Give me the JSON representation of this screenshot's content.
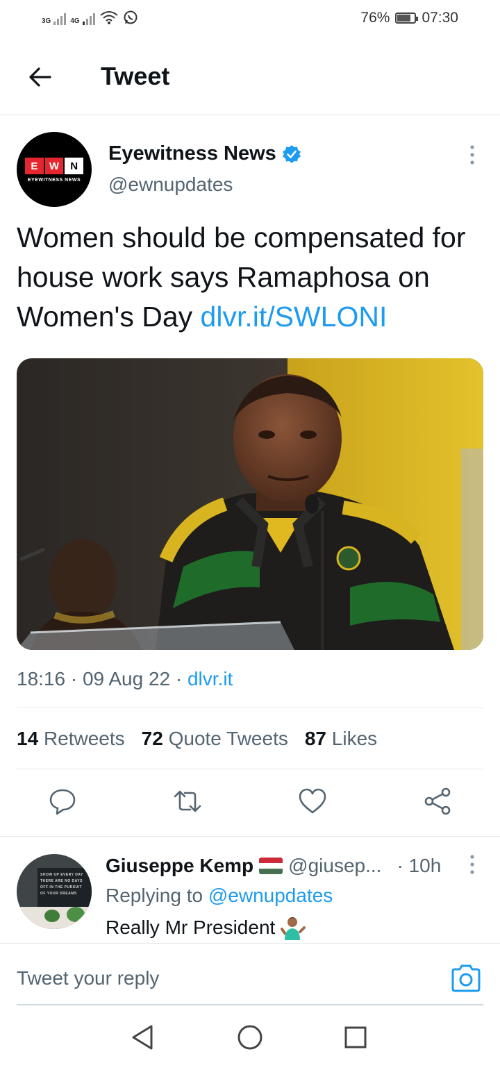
{
  "status_bar": {
    "network1": "3G",
    "network2": "4G",
    "battery": "76%",
    "battery_level": 0.76,
    "time": "07:30"
  },
  "header": {
    "title": "Tweet",
    "back_icon": "arrow-left-icon"
  },
  "tweet": {
    "author_name": "Eyewitness News",
    "author_handle": "@ewnupdates",
    "avatar_logo_letters": [
      "E",
      "W",
      "N"
    ],
    "avatar_logo_sub": "EYEWITNESS NEWS",
    "verified": true,
    "text": "Women should be compensated for house work says Ramaphosa on Women's Day ",
    "link_text": "dlvr.it/SWLONI",
    "time": "18:16",
    "date": "09 Aug 22",
    "source": "dlvr.it",
    "stats": {
      "retweets_count": "14",
      "retweets_label": "Retweets",
      "quotes_count": "72",
      "quotes_label": "Quote Tweets",
      "likes_count": "87",
      "likes_label": "Likes"
    },
    "actions": [
      "reply-icon",
      "retweet-icon",
      "like-icon",
      "share-icon"
    ]
  },
  "reply": {
    "name": "Giuseppe Kemp",
    "handle": "@giusep...",
    "time": "· 10h",
    "replying_prefix": "Replying to ",
    "replying_to": "@ewnupdates",
    "text": "Really Mr President",
    "avatar_lines": [
      "SHOW UP EVERY DAY",
      "THERE ARE NO DAYS",
      "OFF IN THE PURSUIT",
      "OF YOUR DREAMS"
    ]
  },
  "composer": {
    "placeholder": "Tweet your reply"
  },
  "colors": {
    "accent": "#1d9bf0",
    "muted": "#536471",
    "text": "#0f1419",
    "ewn_red": "#e5262e"
  }
}
